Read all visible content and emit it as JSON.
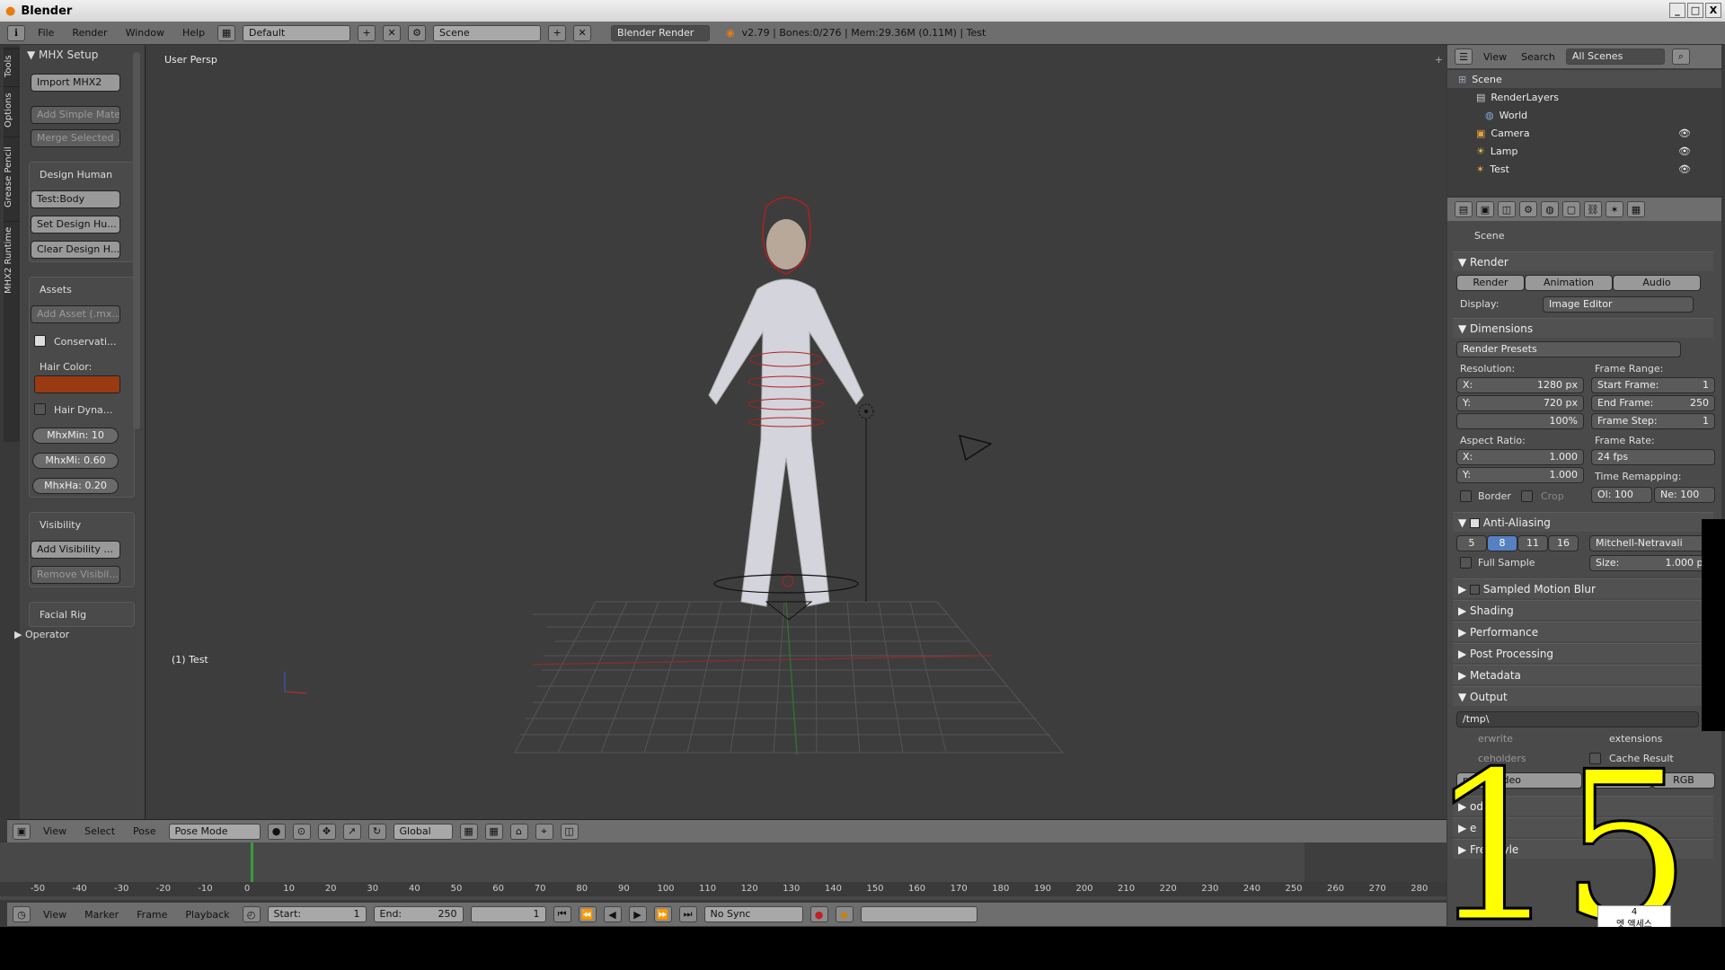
{
  "window": {
    "title": "Blender",
    "controls": [
      "_",
      "□",
      "X"
    ]
  },
  "topbar": {
    "menus": [
      "File",
      "Render",
      "Window",
      "Help"
    ],
    "layout": "Default",
    "scene": "Scene",
    "engine": "Blender Render",
    "stats": "v2.79 | Bones:0/276 | Mem:29.36M (0.11M) | Test"
  },
  "toolshelf": {
    "vtabs": [
      "Tools",
      "Options",
      "Grease Pencil",
      "MHX2 Runtime"
    ],
    "panel_title": "MHX Setup",
    "import_btn": "Import MHX2",
    "add_material_btn": "Add Simple Mate...",
    "merge_btn": "Merge Selected ...",
    "design_human_label": "Design Human",
    "body_btn": "Test:Body",
    "set_design_btn": "Set Design Hu...",
    "clear_design_btn": "Clear Design H...",
    "assets_label": "Assets",
    "add_asset_btn": "Add Asset (.mx...",
    "conservative_label": "Conservati...",
    "hair_color_label": "Hair Color:",
    "hair_color": "#9a3a12",
    "hair_dyn_label": "Hair Dyna...",
    "mhxmin": "MhxMin: 10",
    "mhxmi": "MhxMi: 0.60",
    "mhxha": "MhxHa: 0.20",
    "visibility_label": "Visibility",
    "add_visibility_btn": "Add Visibility ...",
    "remove_visibility_btn": "Remove Visibil...",
    "facial_rig_label": "Facial Rig",
    "operator_label": "Operator"
  },
  "viewport": {
    "view_label": "User Persp",
    "object_label": "(1) Test",
    "header_menus": [
      "View",
      "Select",
      "Pose"
    ],
    "mode": "Pose Mode",
    "orientation": "Global"
  },
  "timeline": {
    "ticks": [
      "-50",
      "-40",
      "-30",
      "-20",
      "-10",
      "0",
      "10",
      "20",
      "30",
      "40",
      "50",
      "60",
      "70",
      "80",
      "90",
      "100",
      "110",
      "120",
      "130",
      "140",
      "150",
      "160",
      "170",
      "180",
      "190",
      "200",
      "210",
      "220",
      "230",
      "240",
      "250",
      "260",
      "270",
      "280"
    ],
    "menus": [
      "View",
      "Marker",
      "Frame",
      "Playback"
    ],
    "start": "Start:",
    "start_val": "1",
    "end": "End:",
    "end_val": "250",
    "current": "1",
    "sync": "No Sync"
  },
  "outliner": {
    "menus": [
      "View",
      "Search"
    ],
    "filter": "All Scenes",
    "items": [
      "Scene",
      "RenderLayers",
      "World",
      "Camera",
      "Lamp",
      "Test"
    ]
  },
  "properties": {
    "context": "Scene",
    "render_panel": "Render",
    "render_btn": "Render",
    "animation_btn": "Animation",
    "audio_btn": "Audio",
    "display_label": "Display:",
    "display_val": "Image Editor",
    "dimensions_panel": "Dimensions",
    "presets": "Render Presets",
    "resolution_label": "Resolution:",
    "res_x": "X:",
    "res_x_val": "1280 px",
    "res_y": "Y:",
    "res_y_val": "720 px",
    "res_pct": "100%",
    "frame_range_label": "Frame Range:",
    "start_frame": "Start Frame:",
    "start_frame_val": "1",
    "end_frame": "End Frame:",
    "end_frame_val": "250",
    "frame_step": "Frame Step:",
    "frame_step_val": "1",
    "aspect_label": "Aspect Ratio:",
    "asp_x": "X:",
    "asp_x_val": "1.000",
    "asp_y": "Y:",
    "asp_y_val": "1.000",
    "frame_rate_label": "Frame Rate:",
    "fps": "24 fps",
    "time_remap_label": "Time Remapping:",
    "old": "Ol: 100",
    "new": "Ne: 100",
    "border": "Border",
    "crop": "Crop",
    "aa_panel": "Anti-Aliasing",
    "aa_samples": [
      "5",
      "8",
      "11",
      "16"
    ],
    "aa_filter": "Mitchell-Netravali",
    "full_sample": "Full Sample",
    "size": "Size:",
    "size_val": "1.000 px",
    "motion_blur": "Sampled Motion Blur",
    "shading": "Shading",
    "performance": "Performance",
    "post_processing": "Post Processing",
    "metadata": "Metadata",
    "output": "Output",
    "output_path": "/tmp\\",
    "overwrite": "erwrite",
    "extensions": "extensions",
    "placeholders": "ceholders",
    "cache_result": "Cache Result",
    "format": "mpeg video",
    "bw": "BW",
    "rgb": "RGB",
    "encoding": "oding",
    "e_label": "e",
    "freestyle": "Freestyle"
  },
  "overlay": {
    "number": "15",
    "stamp_line1": "4",
    "stamp_line2": "엣 액세스"
  }
}
